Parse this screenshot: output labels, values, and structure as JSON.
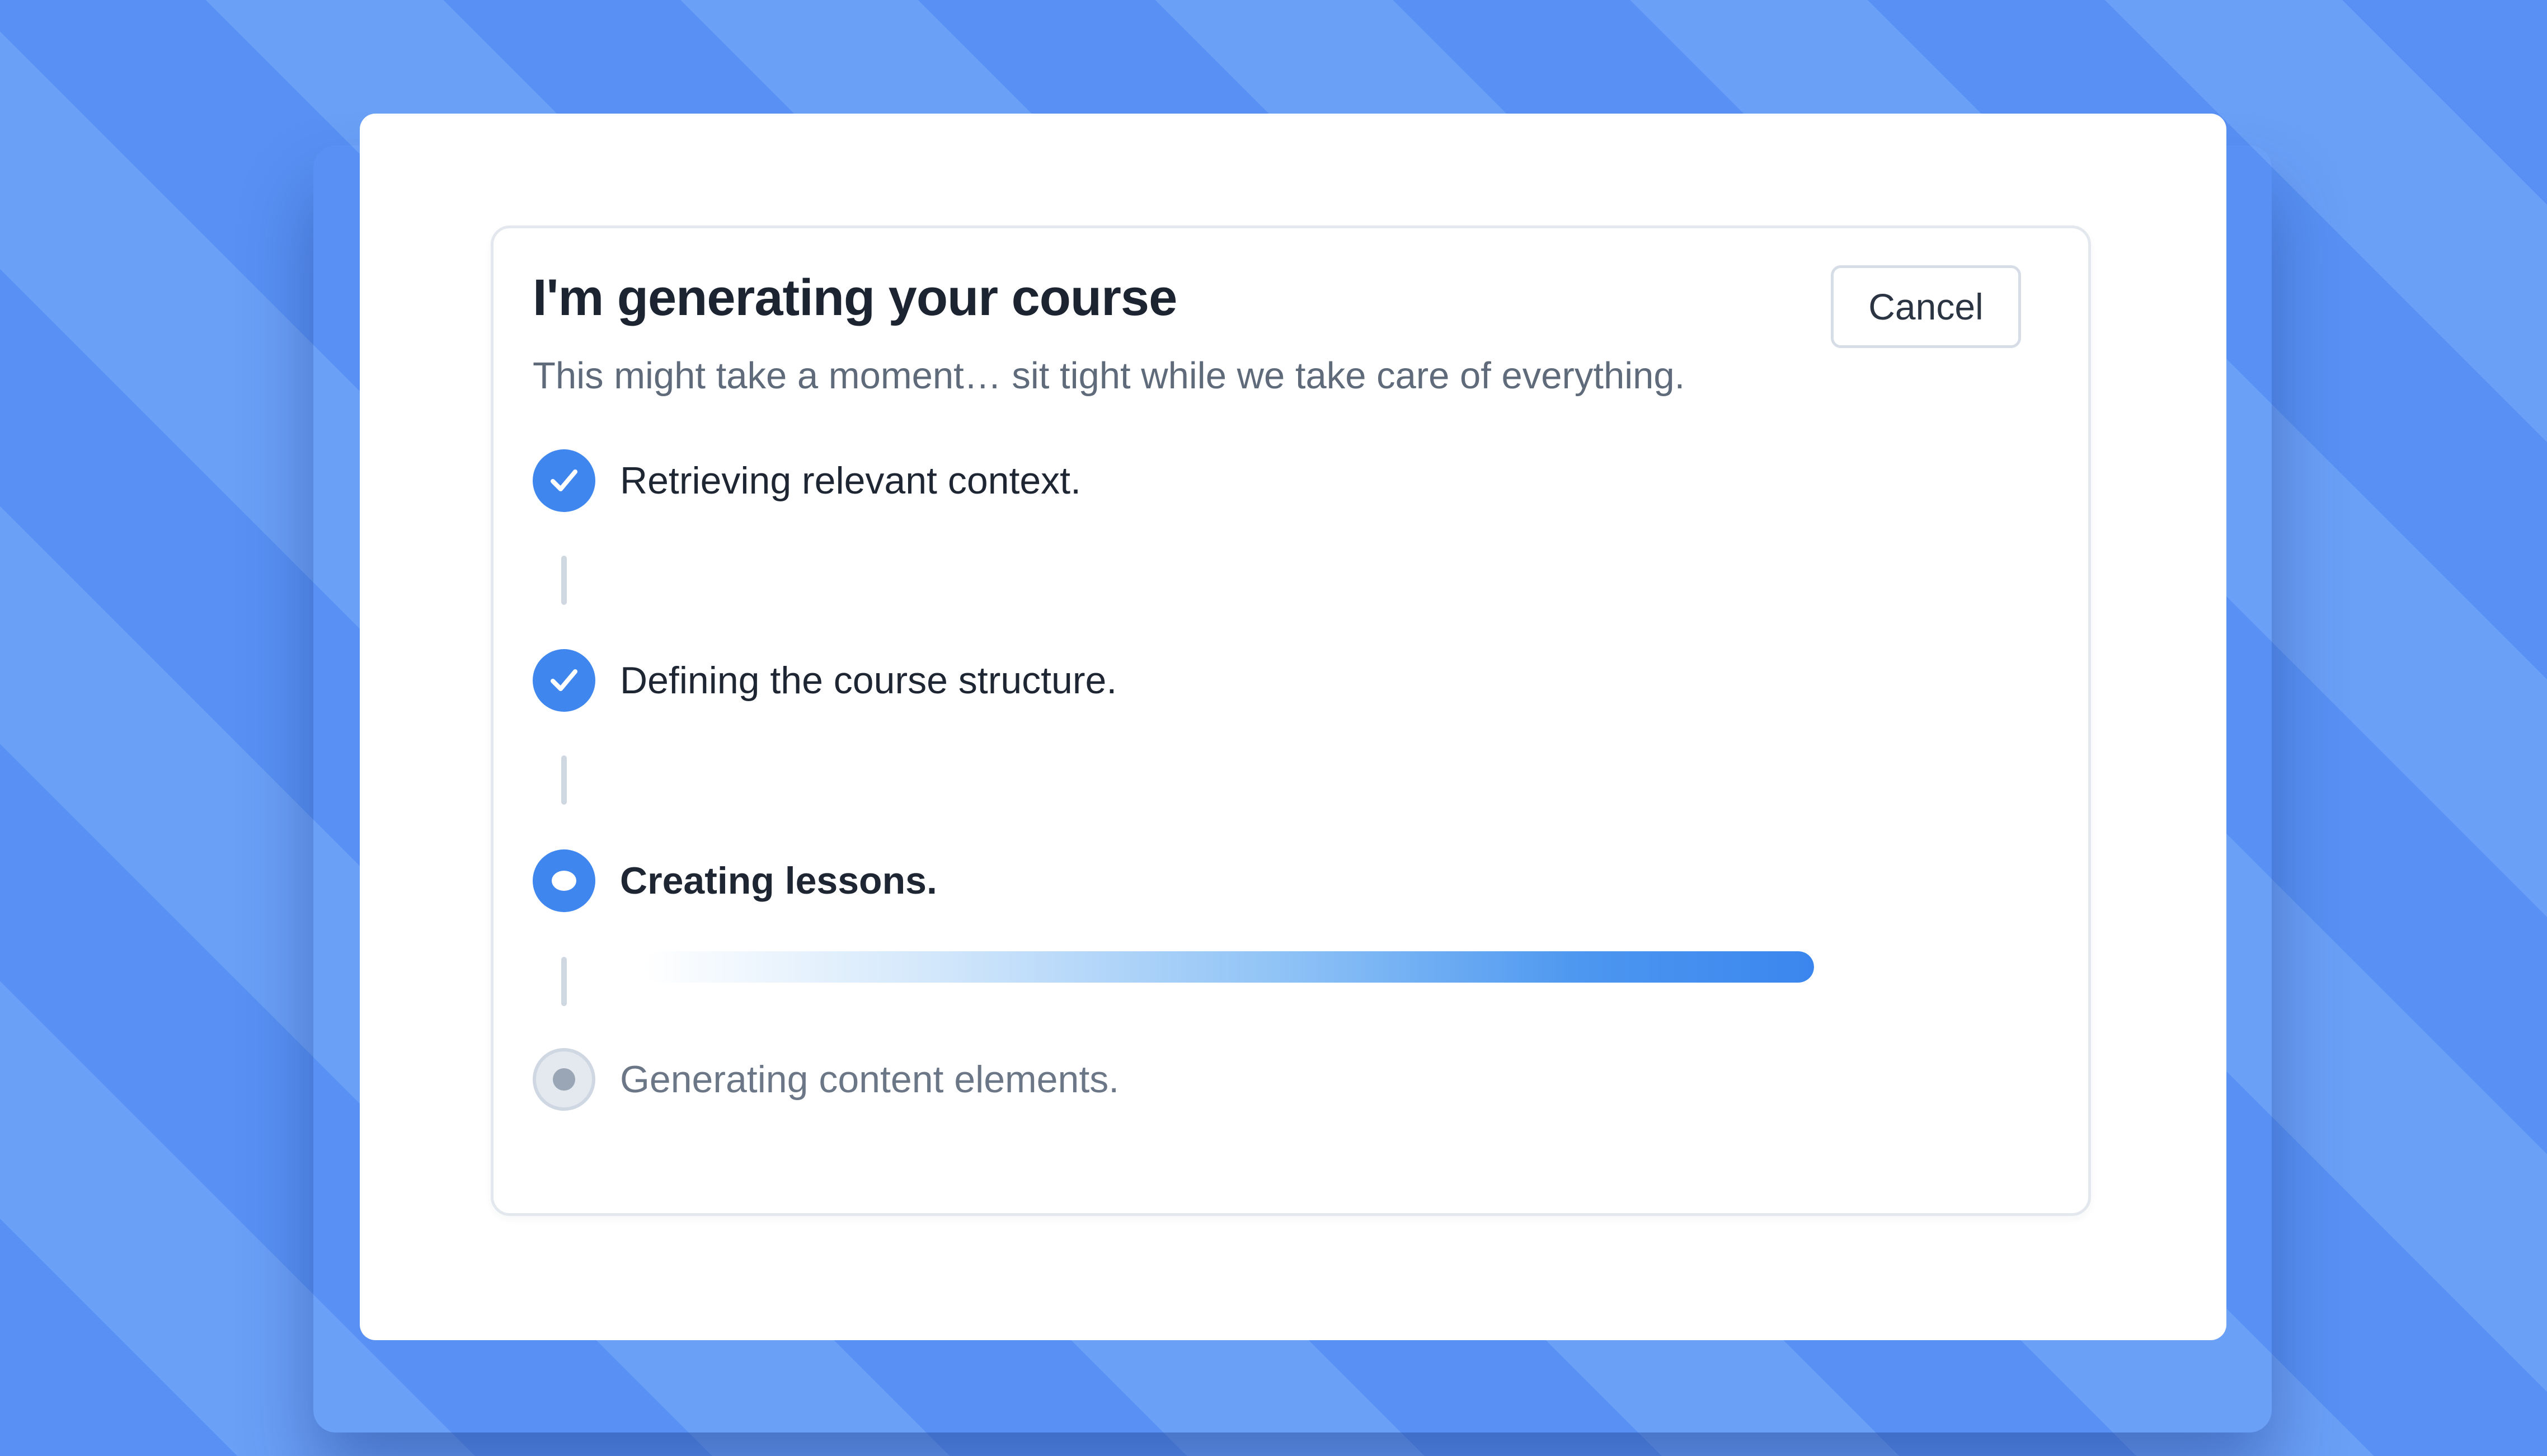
{
  "dialog": {
    "title": "I'm generating your course",
    "subtitle": "This might take a moment… sit tight while we take care of everything.",
    "cancel_label": "Cancel"
  },
  "steps": [
    {
      "label": "Retrieving relevant context.",
      "status": "done",
      "icon": "check-icon"
    },
    {
      "label": "Defining the course structure.",
      "status": "done",
      "icon": "check-icon"
    },
    {
      "label": "Creating lessons.",
      "status": "active",
      "icon": "in-progress-dot-icon"
    },
    {
      "label": "Generating content elements.",
      "status": "pending",
      "icon": "pending-dot-icon"
    }
  ],
  "progress": {
    "value": 1.0
  },
  "colors": {
    "accent": "#3f87ee",
    "background": "#5a93f2",
    "pending": "#9aa6b5"
  }
}
